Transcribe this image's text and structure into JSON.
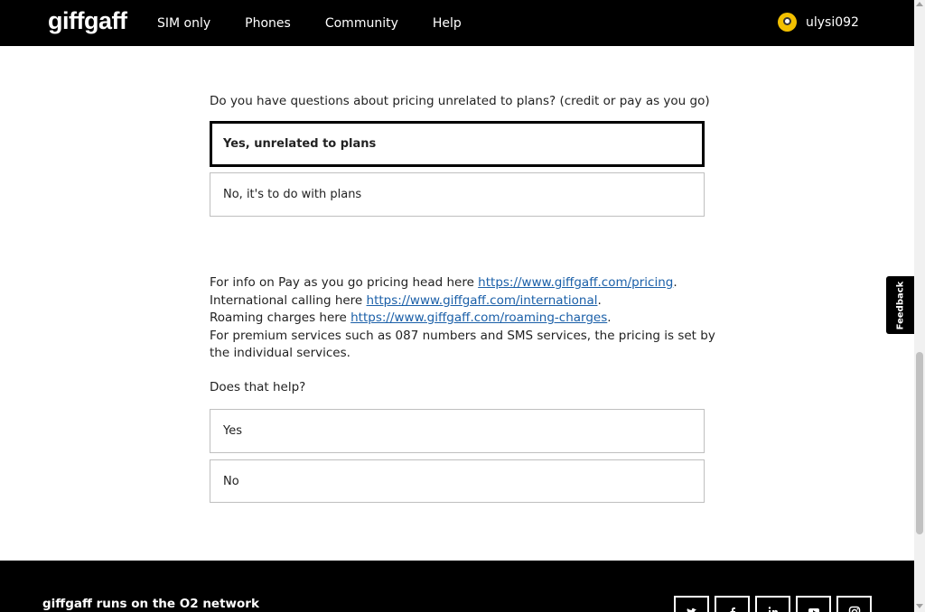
{
  "header": {
    "logo": "giffgaff",
    "nav": [
      "SIM only",
      "Phones",
      "Community",
      "Help"
    ],
    "username": "ulysi092"
  },
  "question": {
    "text": "Do you have questions about pricing unrelated to plans? (credit or pay as you go)",
    "options": [
      "Yes, unrelated to plans",
      "No, it's to do with plans"
    ],
    "selected_index": 0
  },
  "info": {
    "line1_prefix": "For info on Pay as you go pricing head here ",
    "line1_link": "https://www.giffgaff.com/pricing",
    "line1_suffix": ".",
    "line2_prefix": "International calling here ",
    "line2_link": "https://www.giffgaff.com/international",
    "line2_suffix": ".",
    "line3_prefix": "Roaming charges here ",
    "line3_link": "https://www.giffgaff.com/roaming-charges",
    "line3_suffix": ".",
    "line4": "For premium services such as 087 numbers and SMS services, the pricing is set by the individual services."
  },
  "help": {
    "question": "Does that help?",
    "options": [
      "Yes",
      "No"
    ]
  },
  "feedback_label": "Feedback",
  "footer": {
    "text": "giffgaff runs on the O2 network",
    "social_icons": [
      "twitter-icon",
      "facebook-icon",
      "linkedin-icon",
      "youtube-icon",
      "instagram-icon"
    ]
  },
  "colors": {
    "header_bg": "#000000",
    "link": "#1a5fa8",
    "avatar": "#f2c000"
  }
}
